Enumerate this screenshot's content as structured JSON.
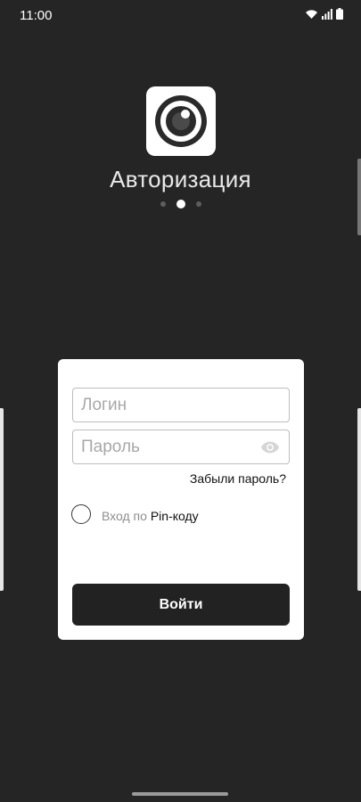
{
  "status_bar": {
    "time": "11:00",
    "icons": [
      "wifi-icon",
      "signal-icon",
      "battery-icon"
    ]
  },
  "header": {
    "logo_icon": "eye-logo-icon",
    "title": "Авторизация",
    "pager": {
      "count": 3,
      "active_index": 1
    }
  },
  "form": {
    "login_placeholder": "Логин",
    "login_value": "",
    "password_placeholder": "Пароль",
    "password_value": "",
    "password_toggle_icon": "eye-icon",
    "forgot_link": "Забыли пароль?",
    "pin_option": {
      "label_prefix": "Вход по",
      "label_highlight": "Pin-коду",
      "checked": false
    },
    "submit_label": "Войти"
  },
  "colors": {
    "background": "#252525",
    "card": "#ffffff",
    "button": "#222222",
    "placeholder": "#a8a8a8"
  }
}
